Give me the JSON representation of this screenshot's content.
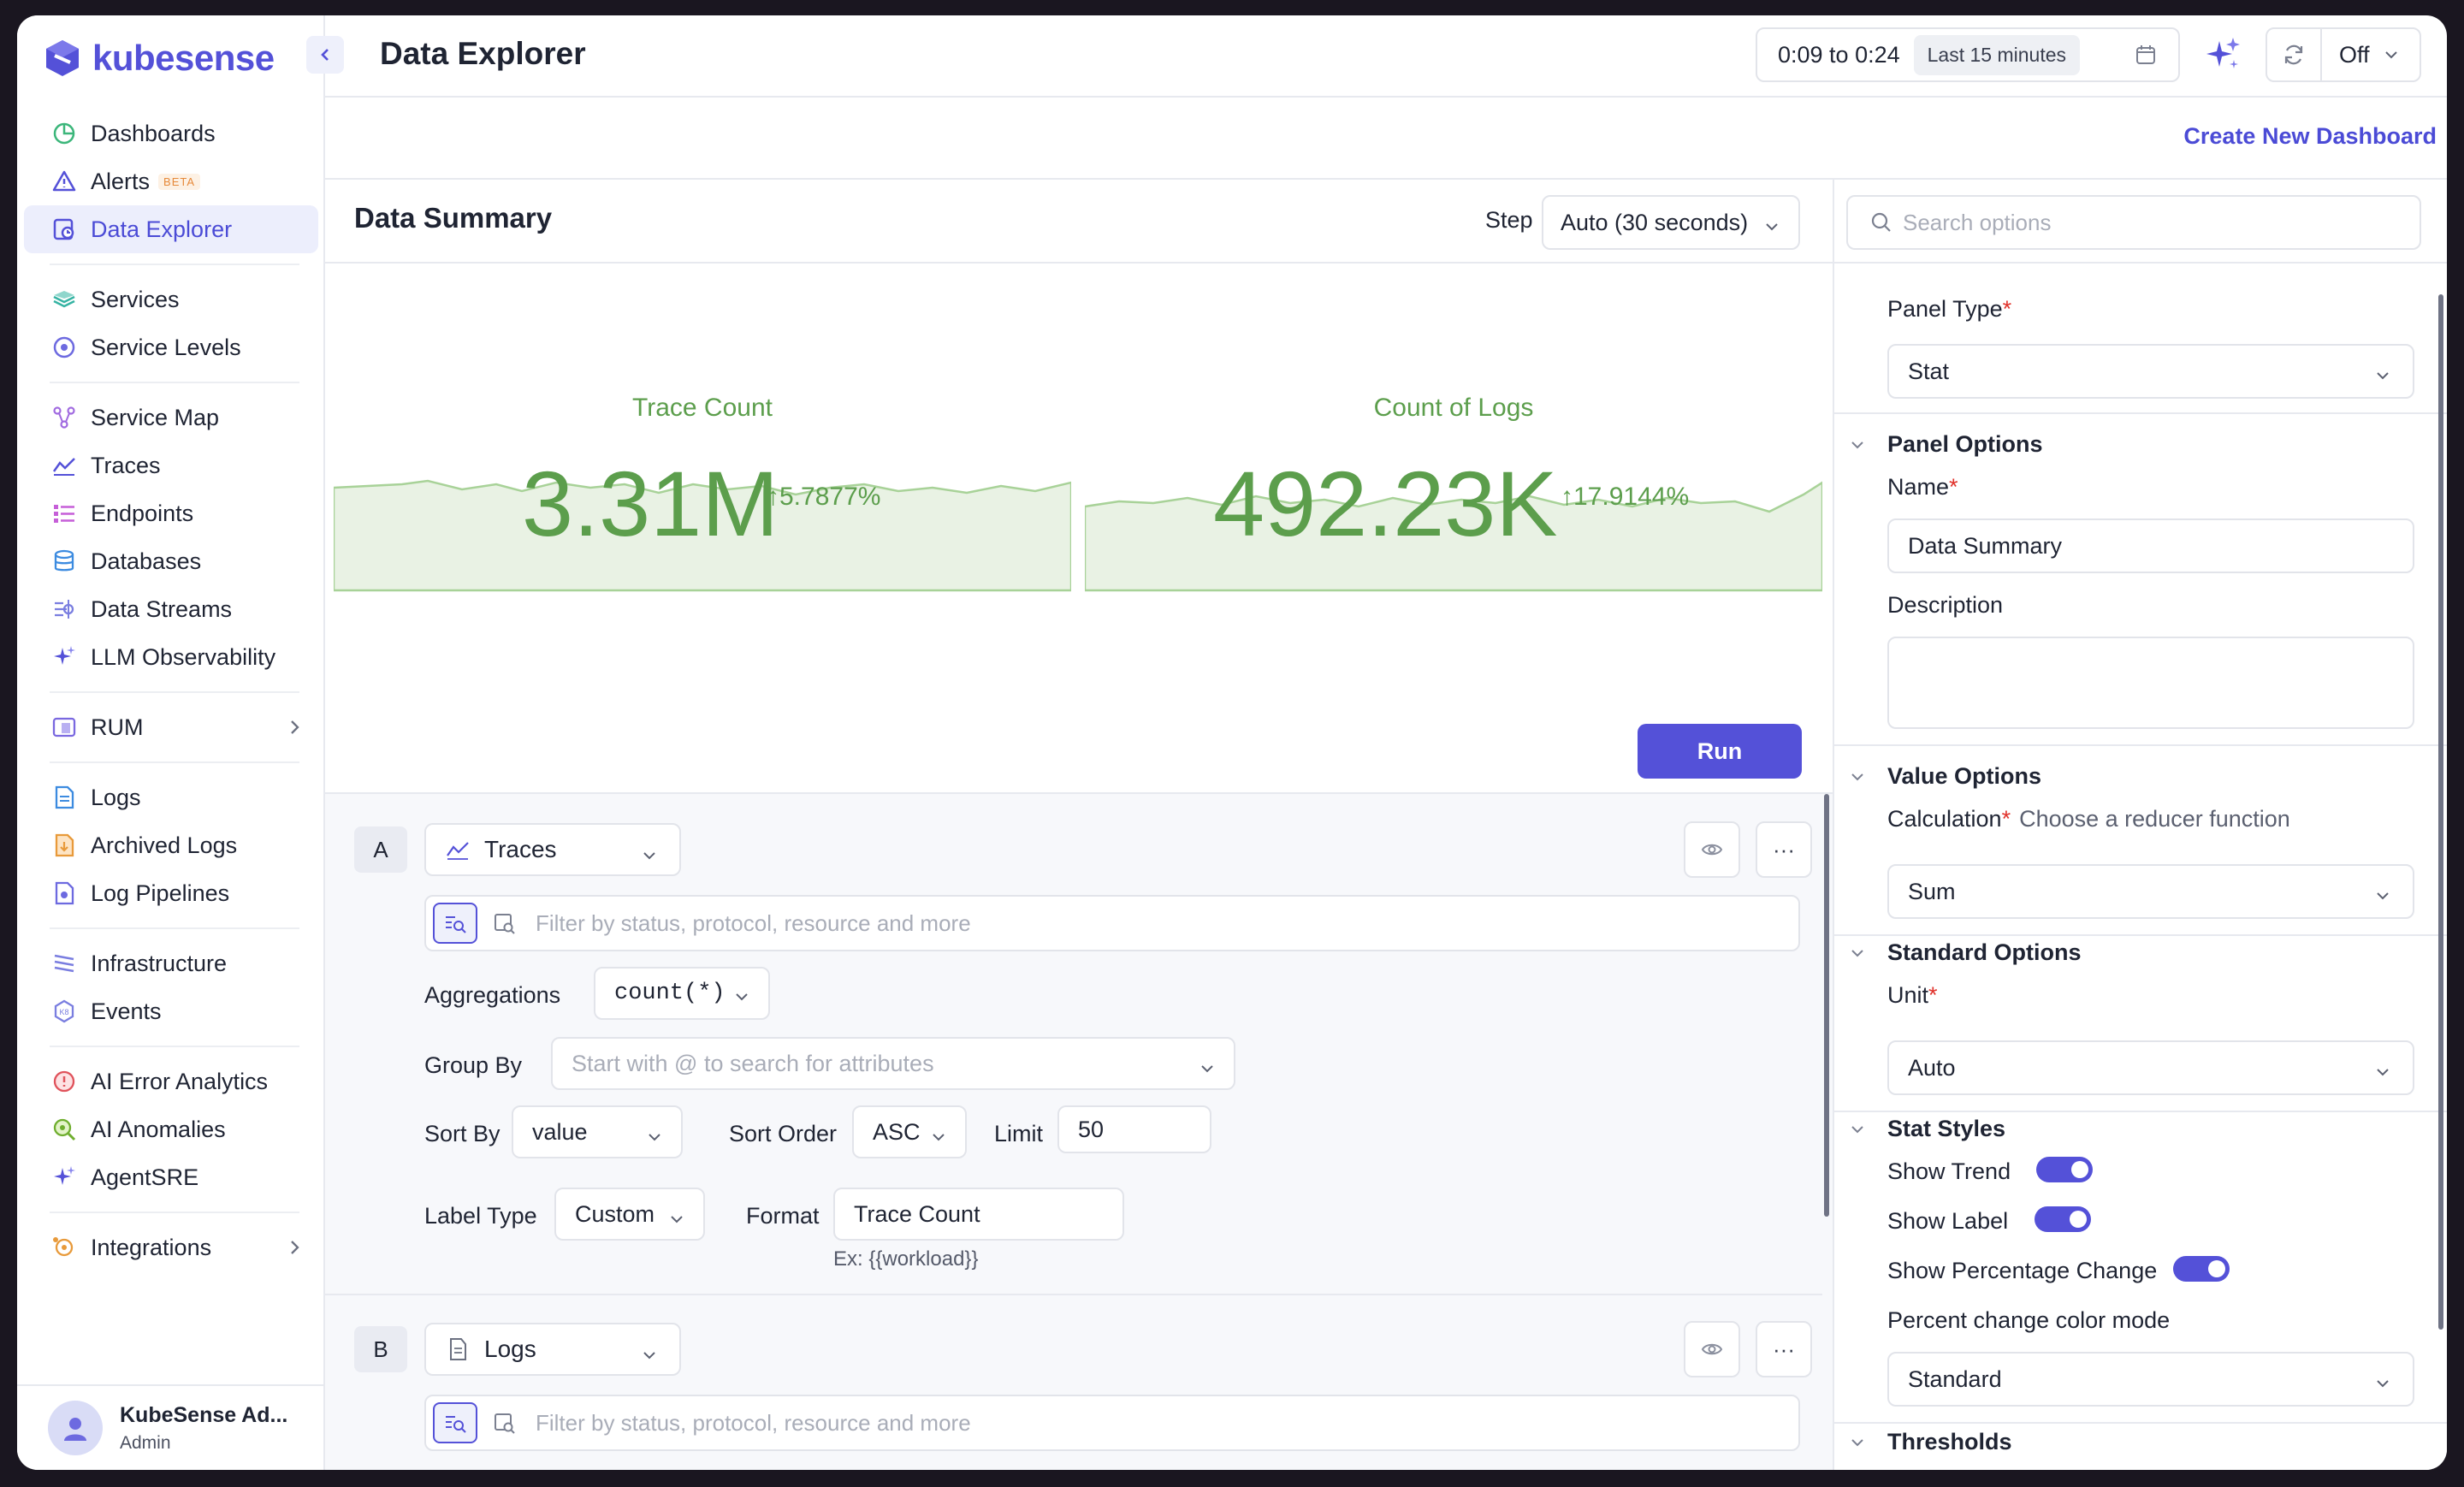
{
  "app": {
    "brand": "kubesense",
    "accent": "#5451d8"
  },
  "sidebar": {
    "items": [
      {
        "label": "Dashboards",
        "icon": "pie-chart-icon"
      },
      {
        "label": "Alerts",
        "icon": "alert-triangle-icon",
        "badge": "BETA"
      },
      {
        "label": "Data Explorer",
        "icon": "data-explorer-icon",
        "active": true
      },
      {
        "label": "Services",
        "icon": "layers-icon"
      },
      {
        "label": "Service Levels",
        "icon": "target-icon"
      },
      {
        "label": "Service Map",
        "icon": "service-map-icon"
      },
      {
        "label": "Traces",
        "icon": "trend-line-icon"
      },
      {
        "label": "Endpoints",
        "icon": "list-icon"
      },
      {
        "label": "Databases",
        "icon": "database-icon"
      },
      {
        "label": "Data Streams",
        "icon": "stream-icon"
      },
      {
        "label": "LLM Observability",
        "icon": "sparkle-icon"
      },
      {
        "label": "RUM",
        "icon": "rum-icon",
        "expandable": true
      },
      {
        "label": "Logs",
        "icon": "file-text-icon"
      },
      {
        "label": "Archived Logs",
        "icon": "archive-icon"
      },
      {
        "label": "Log Pipelines",
        "icon": "pipeline-icon"
      },
      {
        "label": "Infrastructure",
        "icon": "infrastructure-icon"
      },
      {
        "label": "Events",
        "icon": "events-icon"
      },
      {
        "label": "AI Error Analytics",
        "icon": "error-icon"
      },
      {
        "label": "AI Anomalies",
        "icon": "anomaly-icon"
      },
      {
        "label": "AgentSRE",
        "icon": "agent-sparkle-icon"
      },
      {
        "label": "Integrations",
        "icon": "integrations-icon",
        "expandable": true
      }
    ],
    "user": {
      "name": "KubeSense Ad...",
      "role": "Admin"
    }
  },
  "header": {
    "title": "Data Explorer",
    "time_range": "0:09 to 0:24",
    "time_preset": "Last 15 minutes",
    "refresh": "Off"
  },
  "subheader": {
    "create_link": "Create New Dashboard"
  },
  "summary": {
    "title": "Data Summary",
    "step_label": "Step",
    "step_value": "Auto (30 seconds)",
    "run_label": "Run",
    "stats": [
      {
        "label": "Trace Count",
        "value": "3.31M",
        "change": "↑5.7877%"
      },
      {
        "label": "Count of Logs",
        "value": "492.23K",
        "change": "↑17.9144%"
      }
    ]
  },
  "queries": {
    "filter_placeholder": "Filter by status, protocol, resource and more",
    "a": {
      "letter": "A",
      "source": "Traces",
      "aggregations_label": "Aggregations",
      "aggregation": "count(*)",
      "group_by_label": "Group By",
      "group_by_placeholder": "Start with @ to search for attributes",
      "sort_by_label": "Sort By",
      "sort_by": "value",
      "sort_order_label": "Sort Order",
      "sort_order": "ASC",
      "limit_label": "Limit",
      "limit": "50",
      "label_type_label": "Label Type",
      "label_type": "Custom",
      "format_label": "Format",
      "format": "Trace Count",
      "format_hint": "Ex: {{workload}}"
    },
    "b": {
      "letter": "B",
      "source": "Logs"
    },
    "more": "···"
  },
  "options": {
    "search_placeholder": "Search options",
    "panel_type_label": "Panel Type",
    "panel_type": "Stat",
    "panel_options": "Panel Options",
    "name_label": "Name",
    "name_value": "Data Summary",
    "description_label": "Description",
    "value_options": "Value Options",
    "calculation_label": "Calculation",
    "calculation_hint": "Choose a reducer function",
    "calculation": "Sum",
    "standard_options": "Standard Options",
    "unit_label": "Unit",
    "unit": "Auto",
    "stat_styles": "Stat Styles",
    "show_trend": "Show Trend",
    "show_label": "Show Label",
    "show_pct": "Show Percentage Change",
    "pct_mode_label": "Percent change color mode",
    "pct_mode": "Standard",
    "thresholds": "Thresholds",
    "required_mark": "*"
  }
}
